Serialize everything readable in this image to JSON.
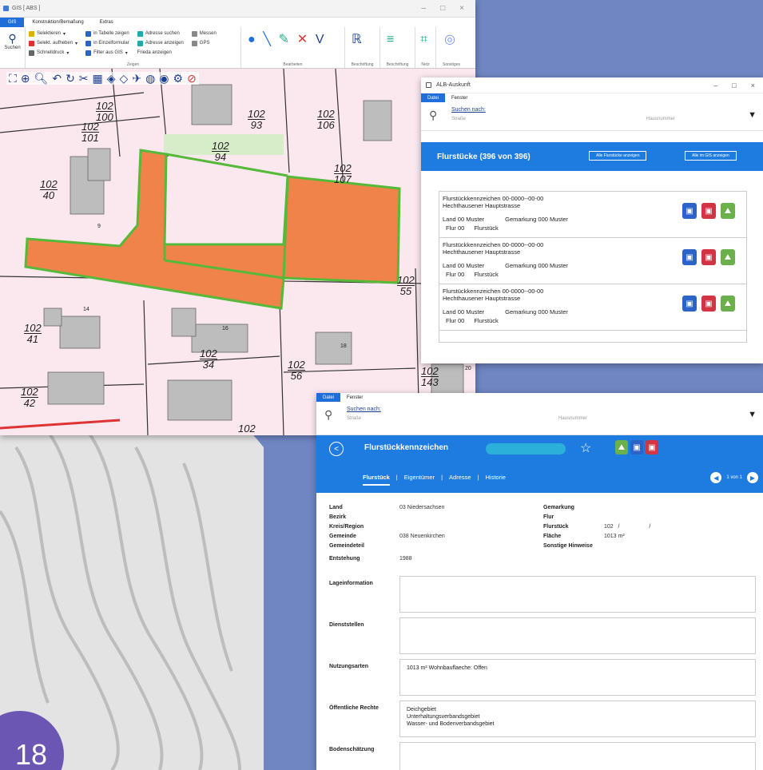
{
  "gis": {
    "title": "GIS [ ABS ]",
    "menu": [
      "GIS",
      "Konstruktion/Bemaßung",
      "Extras"
    ],
    "ribbon": {
      "search_label": "Suchen",
      "col1": [
        "Selektieren",
        "Selekt. aufheben",
        "Schnelldruck"
      ],
      "col2": [
        "in Tabelle zeigen",
        "in Einzelformular",
        "Filter aus GIS"
      ],
      "col3": [
        "Adresse suchen",
        "Adresse anzeigen",
        "Frieda anzeigen"
      ],
      "col4": [
        "Messen",
        "GPS"
      ],
      "group_zeigen": "Zeigen",
      "group_bearbeiten": "Bearbeiten",
      "group_beschriftung": "Beschriftung",
      "group_beschriftung2": "Beschriftung",
      "group_netz": "Netz",
      "group_sonstiges": "Sonstiges"
    },
    "map_labels": [
      {
        "top": "102",
        "bottom": "100"
      },
      {
        "top": "102",
        "bottom": "101"
      },
      {
        "top": "102",
        "bottom": "93"
      },
      {
        "top": "102",
        "bottom": "106"
      },
      {
        "top": "102",
        "bottom": "94"
      },
      {
        "top": "102",
        "bottom": "107"
      },
      {
        "top": "102",
        "bottom": "40"
      },
      {
        "top": "102",
        "bottom": "55"
      },
      {
        "top": "102",
        "bottom": "41"
      },
      {
        "top": "102",
        "bottom": "34"
      },
      {
        "top": "102",
        "bottom": "56"
      },
      {
        "top": "102",
        "bottom": "143"
      },
      {
        "top": "102",
        "bottom": "42"
      },
      {
        "top": "102",
        "bottom": ""
      }
    ],
    "house_numbers": [
      "9",
      "14",
      "16",
      "18",
      "20"
    ]
  },
  "alb": {
    "title": "ALB-Auskunft",
    "tabs": [
      "Datei",
      "Fenster"
    ],
    "search_link": "Suchen nach:",
    "search_street": "Straße",
    "search_house": "Hausnummer",
    "bar_title": "Flurstücke (396 von 396)",
    "btn_all": "Alle Flurstücke anzeigen",
    "btn_gis": "Alle im GIS anzeigen",
    "results": [
      {
        "line1": "Flurstückkennzeichen  00-0000--00-00",
        "line2": "Hechthausener Hauptstrasse",
        "land": "Land  00 Muster",
        "gem": "Gemarkung    000 Muster",
        "flur": "Flur  00",
        "fs": "Flurstück"
      },
      {
        "line1": "Flurstückkennzeichen  00-0000--00-00",
        "line2": "Hechthausener Hauptstrasse",
        "land": "Land  00 Muster",
        "gem": "Gemarkung    000 Muster",
        "flur": "Flur  00",
        "fs": "Flurstück"
      },
      {
        "line1": "Flurstückkennzeichen  00-0000--00-00",
        "line2": "Hechthausener Hauptstrasse",
        "land": "Land  00 Muster",
        "gem": "Gemarkung    000 Muster",
        "flur": "Flur  00",
        "fs": "Flurstück"
      }
    ]
  },
  "detail": {
    "tabs": [
      "Datei",
      "Fenster"
    ],
    "search_link": "Suchen nach:",
    "search_street": "Straße",
    "search_house": "Hausnummer",
    "title": "Flurstückkennzeichen",
    "subtabs": [
      "Flurstück",
      "Eigentümer",
      "Adresse",
      "Historie"
    ],
    "pager": "1 von 1",
    "left_labels": [
      "Land",
      "Bezirk",
      "Kreis/Region",
      "Gemeinde",
      "Gemeindeteil",
      "Entstehung"
    ],
    "left_values": [
      "03 Niedersachsen",
      "",
      "",
      "038 Neuenkirchen",
      "",
      "1988"
    ],
    "right_labels": [
      "Gemarkung",
      "Flur",
      "Flurstück",
      "Fläche",
      "Sonstige Hinweise"
    ],
    "right_values": [
      "",
      "",
      "102   /                   /",
      "1013 m²",
      ""
    ],
    "sections": [
      {
        "label": "Lageinformation",
        "text": ""
      },
      {
        "label": "Dienststellen",
        "text": ""
      },
      {
        "label": "Nutzungsarten",
        "text": "1013 m² Wohnbauflaeche: Offen"
      },
      {
        "label": "Öffentliche Rechte",
        "text": "Deichgebiet\nUnterhaltungsverbandsgebiet\nWasser- und Bodenverbandsgebiet"
      },
      {
        "label": "Bodenschätzung",
        "text": ""
      }
    ]
  },
  "page_number": "18",
  "colors": {
    "accent": "#1e7be0",
    "parcel": "#ef8349",
    "parcel_border": "#55b93a",
    "bg": "#6f86c3"
  }
}
